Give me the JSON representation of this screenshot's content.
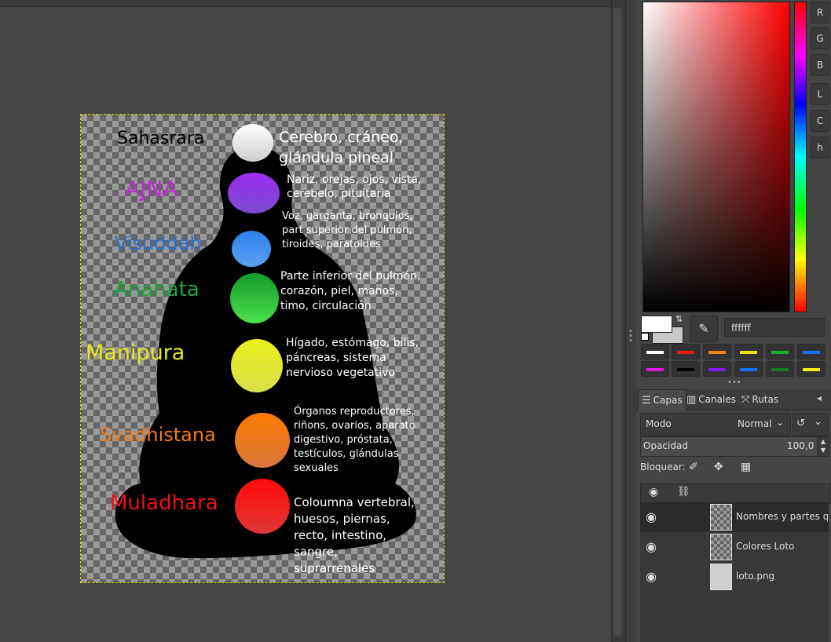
{
  "canvas": {
    "chakras": [
      {
        "name": "Sahasrara",
        "color": "#000000",
        "desc": "Cerebro, cráneo,\nglándula pineal",
        "orb_top": "#ffffff",
        "orb_bottom": "#cfcfcf"
      },
      {
        "name": "AJNA",
        "color": "#c22bd6",
        "desc": "Nariz, orejas, ojos, vista,\ncerebelo, pituitaria",
        "orb_top": "#9a2cf0",
        "orb_bottom": "#7b4bd0"
      },
      {
        "name": "Visuddah",
        "color": "#2b6fd8",
        "desc": "Voz, garganta, bronquios,\npart superior del pulmón,\ntiroides, paratoides",
        "orb_top": "#2f7ff0",
        "orb_bottom": "#5aa0f0"
      },
      {
        "name": "Anahata",
        "color": "#1aa83a",
        "desc": "Parte inferior del pulmón,\ncorazón, piel, manos,\ntimo, circulación",
        "orb_top": "#129a2a",
        "orb_bottom": "#4de04d"
      },
      {
        "name": "Manipura",
        "color": "#e8e81a",
        "desc": "Hígado, estómago, bilis,\npáncreas, sistema\nnervioso vegetativo",
        "orb_top": "#ecf01a",
        "orb_bottom": "#d6e04a"
      },
      {
        "name": "Svadhistana",
        "color": "#f07c14",
        "desc": "Órganos reproductores,\nriñons, ovarios, aparato\ndigestivo, próstata,\ntestículos, glándulas\nsexuales",
        "orb_top": "#ff7a00",
        "orb_bottom": "#d8783e"
      },
      {
        "name": "Muladhara",
        "color": "#ee1111",
        "desc": "Coloumna vertebral,\nhuesos, piernas,\nrecto, intestino,\nsangre,\nsuprarrenales",
        "orb_top": "#ff0a0a",
        "orb_bottom": "#e03636"
      }
    ]
  },
  "color_panel": {
    "channels": [
      "R",
      "G",
      "B",
      "L",
      "C",
      "h"
    ],
    "hex_value": "ffffff",
    "palette": [
      "#ffffff",
      "#e31a1a",
      "#f08018",
      "#f0e018",
      "#18b030",
      "#1870f0",
      "#e018e0",
      "#000000",
      "#8018f0",
      "#1870f0",
      "#108020",
      "#f0f018"
    ]
  },
  "tabs": [
    {
      "label": "Capas"
    },
    {
      "label": "Canales"
    },
    {
      "label": "Rutas"
    }
  ],
  "layers_panel": {
    "mode_label": "Modo",
    "mode_value": "Normal",
    "opacity_label": "Opacidad",
    "opacity_value": "100,0",
    "lock_label": "Bloquear:",
    "layers": [
      {
        "name": "Nombres y partes que"
      },
      {
        "name": "Colores Loto"
      },
      {
        "name": "loto.png"
      }
    ]
  }
}
